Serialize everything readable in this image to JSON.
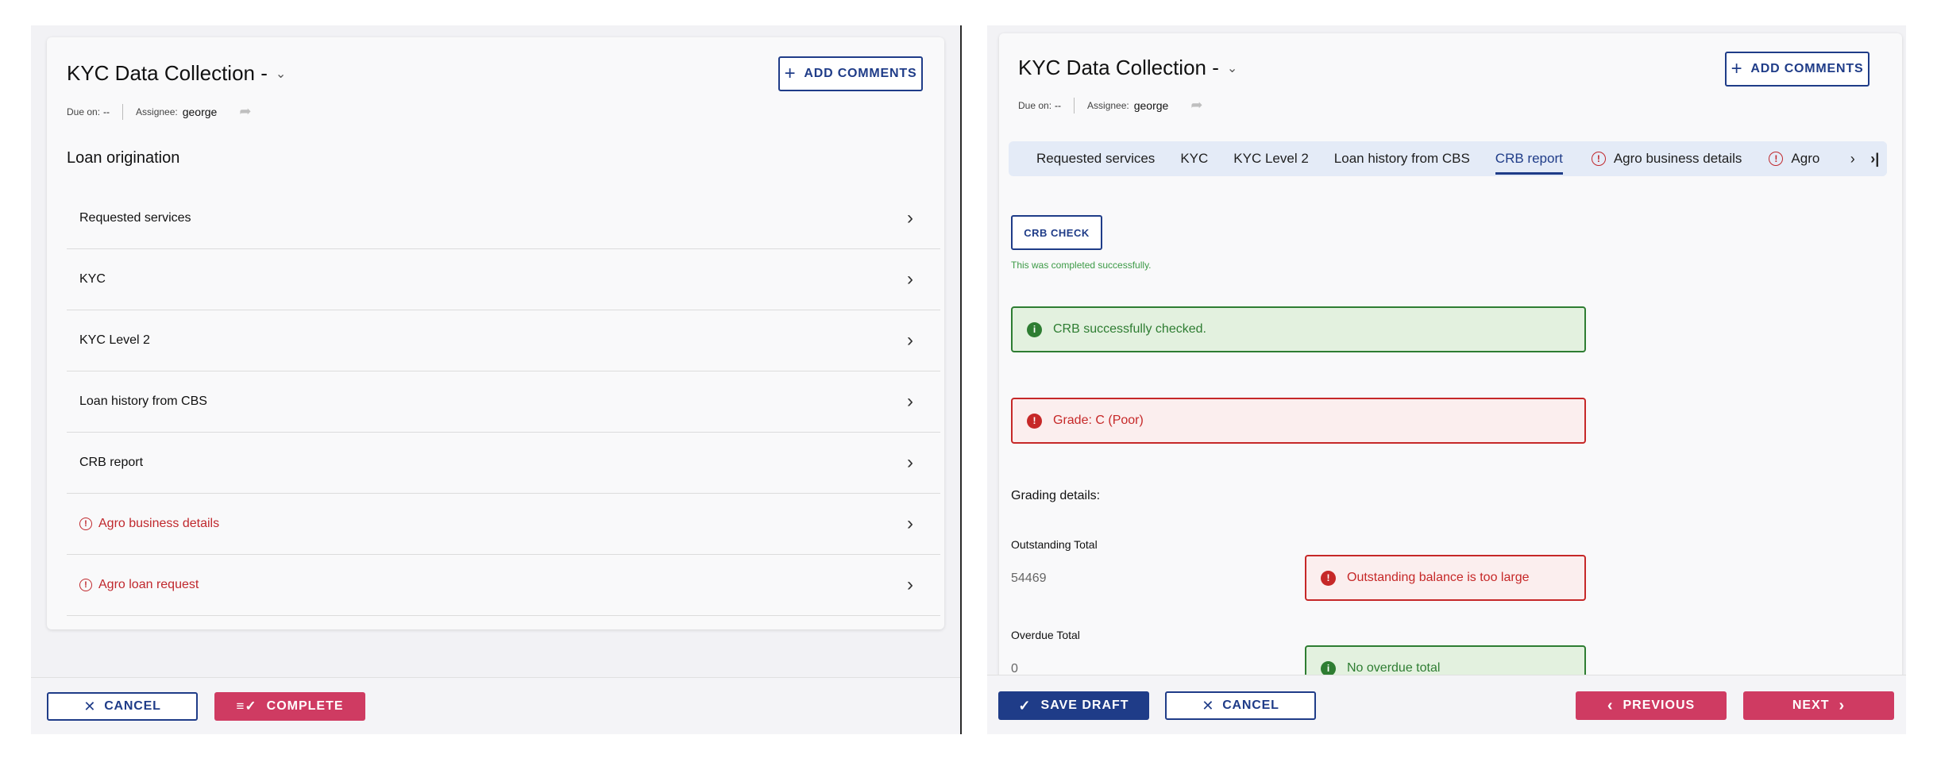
{
  "left": {
    "title": "KYC Data Collection -",
    "due_label": "Due on:",
    "due_value": "--",
    "assignee_label": "Assignee:",
    "assignee_value": "george",
    "add_comments": "ADD COMMENTS",
    "section_title": "Loan origination",
    "items": [
      {
        "label": "Requested services",
        "error": false
      },
      {
        "label": "KYC",
        "error": false
      },
      {
        "label": "KYC Level 2",
        "error": false
      },
      {
        "label": "Loan history from CBS",
        "error": false
      },
      {
        "label": "CRB report",
        "error": false
      },
      {
        "label": "Agro business details",
        "error": true
      },
      {
        "label": "Agro loan request",
        "error": true
      }
    ],
    "footer": {
      "cancel": "CANCEL",
      "complete": "COMPLETE"
    }
  },
  "right": {
    "title": "KYC Data Collection -",
    "due_label": "Due on:",
    "due_value": "--",
    "assignee_label": "Assignee:",
    "assignee_value": "george",
    "add_comments": "ADD COMMENTS",
    "tabs": [
      {
        "label": "Requested services",
        "active": false,
        "error": false
      },
      {
        "label": "KYC",
        "active": false,
        "error": false
      },
      {
        "label": "KYC Level 2",
        "active": false,
        "error": false
      },
      {
        "label": "Loan history from CBS",
        "active": false,
        "error": false
      },
      {
        "label": "CRB report",
        "active": true,
        "error": false
      },
      {
        "label": "Agro business details",
        "active": false,
        "error": true
      },
      {
        "label": "Agro",
        "active": false,
        "error": true
      }
    ],
    "crb_check_button": "CRB CHECK",
    "completed_message": "This was completed successfully.",
    "alert_success": "CRB successfully checked.",
    "alert_grade": "Grade: C (Poor)",
    "grading_details": "Grading details:",
    "outstanding_label": "Outstanding Total",
    "outstanding_value": "54469",
    "outstanding_alert": "Outstanding balance is too large",
    "overdue_label": "Overdue Total",
    "overdue_value": "0",
    "overdue_alert": "No overdue total",
    "footer": {
      "save_draft": "SAVE DRAFT",
      "cancel": "CANCEL",
      "previous": "PREVIOUS",
      "next": "NEXT"
    }
  },
  "colors": {
    "navy": "#1f3c88",
    "pink": "#cf3b62",
    "error": "#c0282d",
    "success": "#2e7d32"
  },
  "icons": [
    "chevron-down-icon",
    "share-icon",
    "plus-icon",
    "chevron-right-icon",
    "error-icon",
    "close-icon",
    "checklist-icon",
    "check-icon",
    "success-icon",
    "chevron-left-icon",
    "last-page-icon"
  ]
}
